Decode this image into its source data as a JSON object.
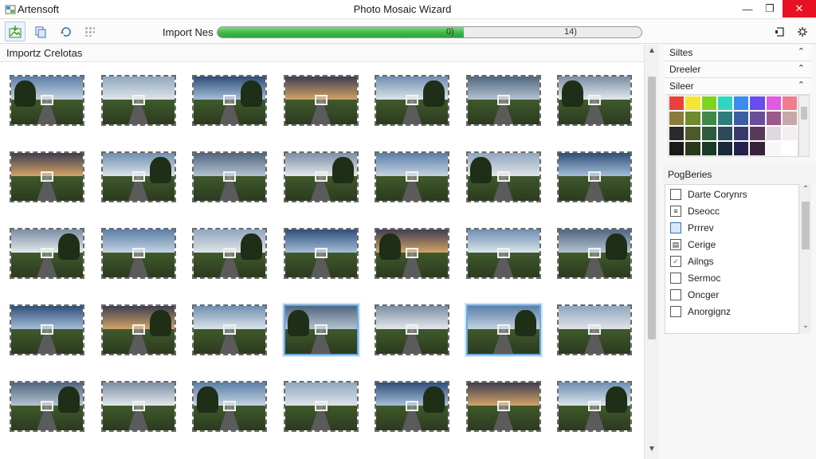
{
  "app": {
    "name": "Artensoft",
    "title": "Photo Mosaic Wizard"
  },
  "window_controls": {
    "minimize": "—",
    "maximize": "❐",
    "close": "✕"
  },
  "toolbar": {
    "import_label": "Import Nes",
    "progress": {
      "fraction": 0.58,
      "left_text": "0)",
      "right_text": "14)"
    },
    "right_icons": [
      "panel-icon",
      "settings-icon"
    ]
  },
  "left_panel": {
    "header": "Importz Crelotas",
    "thumbnail_rows": 5,
    "thumbnail_cols": 7,
    "selected_thumbnails": [
      "r3c3",
      "r3c5"
    ]
  },
  "right_panel": {
    "sections": [
      {
        "label": "Siltes"
      },
      {
        "label": "Dreeler"
      },
      {
        "label": "Sileer"
      }
    ],
    "palette": [
      "#e8423b",
      "#f5e634",
      "#7ed321",
      "#2ed8c0",
      "#3a8cf0",
      "#6b4cf0",
      "#e05be0",
      "#f07c8c",
      "#8a7b3e",
      "#6e8b2e",
      "#3e8a4a",
      "#2f7c7c",
      "#3b5fa0",
      "#6b4e9a",
      "#9a5b8a",
      "#c8a8a8",
      "#2b2b2b",
      "#4a5a2a",
      "#2e5a3e",
      "#2c4a5a",
      "#3a3a6a",
      "#5a3a5a",
      "#e0d8e0",
      "#f2eef2",
      "#1a1a1a",
      "#2a3a1a",
      "#1a3a2a",
      "#1a2a3a",
      "#22224a",
      "#3a223a",
      "#f8f6f8",
      "#ffffff"
    ],
    "properties_header": "PogBeries",
    "properties": [
      {
        "label": "Darte Corynrs",
        "icon": "checkbox-icon"
      },
      {
        "label": "Dseocc",
        "icon": "list-icon"
      },
      {
        "label": "Prrrev",
        "icon": "preview-icon"
      },
      {
        "label": "Cerige",
        "icon": "document-icon"
      },
      {
        "label": "Ailngs",
        "icon": "checkbox-checked-icon"
      },
      {
        "label": "Sermoc",
        "icon": "checkbox-icon"
      },
      {
        "label": "Oncger",
        "icon": "checkbox-icon"
      },
      {
        "label": "Anorgignz",
        "icon": "checkbox-icon"
      }
    ]
  },
  "colors": {
    "accent": "#3fb64a",
    "selection": "#6aa9e0",
    "close": "#e81123"
  }
}
